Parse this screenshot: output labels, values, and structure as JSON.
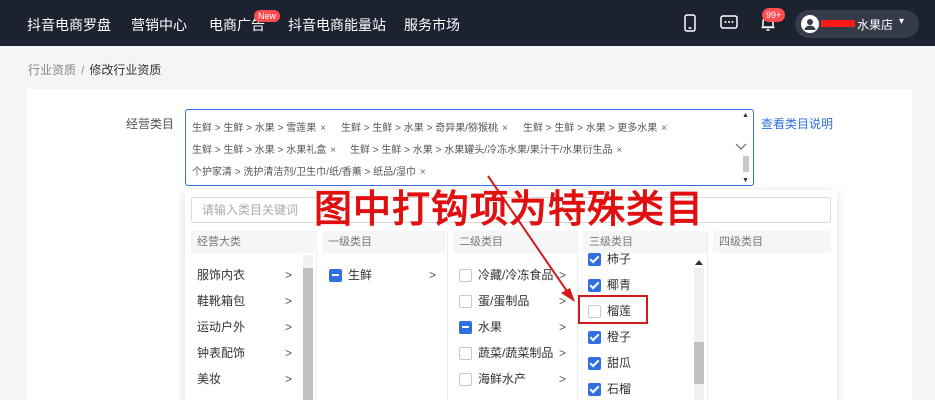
{
  "nav": {
    "items": [
      "抖音电商罗盘",
      "营销中心",
      "电商广告",
      "抖音电商能量站",
      "服务市场"
    ],
    "new_badge": "New",
    "message_badge": "99+",
    "user_name": "水果店",
    "user_caret": "▾"
  },
  "breadcrumb": {
    "parent": "行业资质",
    "separator": "/",
    "current": "修改行业资质"
  },
  "form": {
    "label": "经营类目",
    "help_link": "查看类目说明",
    "selected_tags": [
      "生鲜 > 生鲜 > 水果 > 雪莲果",
      "生鲜 > 生鲜 > 水果 > 奇异果/猕猴桃",
      "生鲜 > 生鲜 > 水果 > 更多水果",
      "生鲜 > 生鲜 > 水果 > 水果礼盒",
      "生鲜 > 生鲜 > 水果 > 水果罐头/冷冻水果/果汁干/水果衍生品",
      "个护家清 > 洗护清洁剂/卫生巾/纸/香薰 > 纸品/湿巾"
    ],
    "tag_close": "×"
  },
  "picker": {
    "search_placeholder": "请输入类目关键词",
    "columns": [
      "经营大类",
      "一级类目",
      "二级类目",
      "三级类目",
      "四级类目"
    ],
    "col0": [
      "服饰内衣",
      "鞋靴箱包",
      "运动户外",
      "钟表配饰",
      "美妆"
    ],
    "col1": [
      {
        "label": "生鲜",
        "state": "partial"
      }
    ],
    "col2": [
      {
        "label": "冷藏/冷冻食品",
        "state": "empty"
      },
      {
        "label": "蛋/蛋制品",
        "state": "empty"
      },
      {
        "label": "水果",
        "state": "partial"
      },
      {
        "label": "蔬菜/蔬菜制品",
        "state": "empty"
      },
      {
        "label": "海鲜水产",
        "state": "empty"
      }
    ],
    "col3": [
      {
        "label": "柿子",
        "state": "checked"
      },
      {
        "label": "椰青",
        "state": "checked"
      },
      {
        "label": "榴莲",
        "state": "empty"
      },
      {
        "label": "橙子",
        "state": "checked"
      },
      {
        "label": "甜瓜",
        "state": "checked"
      },
      {
        "label": "石榴",
        "state": "checked"
      }
    ],
    "arrow": ">"
  },
  "annotation": {
    "text": "图中打钩项为特殊类目",
    "color": "#e01010"
  },
  "colors": {
    "nav_bg": "#1c2230",
    "accent": "#2f6fdf",
    "badge": "#ff4d4f"
  }
}
